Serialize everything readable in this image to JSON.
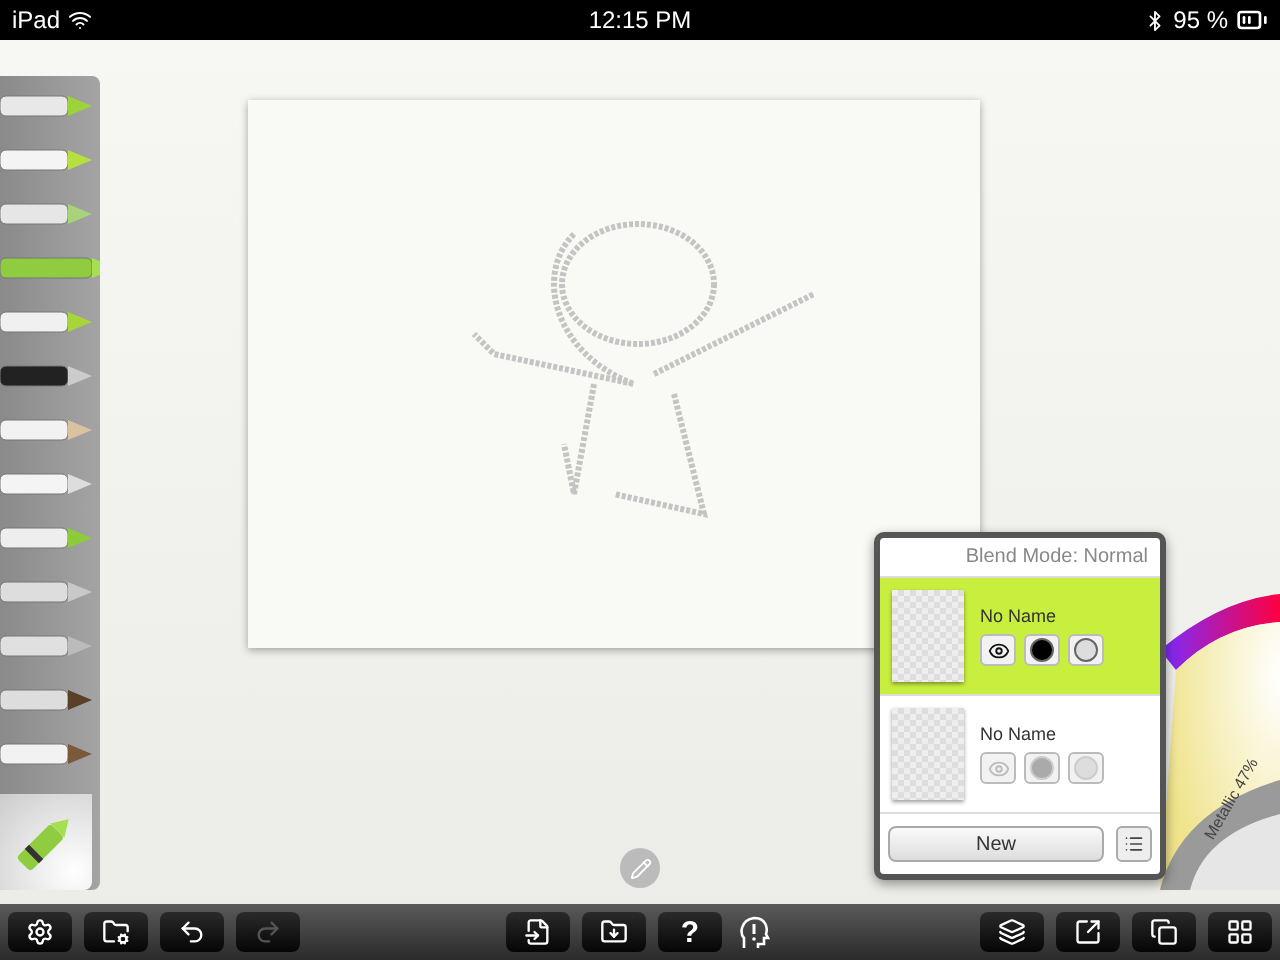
{
  "status_bar": {
    "device": "iPad",
    "time": "12:15 PM",
    "battery": "95 %"
  },
  "tools": [
    {
      "kind": "bucket",
      "selected": false
    },
    {
      "kind": "eraser",
      "selected": false
    },
    {
      "kind": "chalk",
      "selected": false
    },
    {
      "kind": "crayon",
      "selected": true
    },
    {
      "kind": "marker",
      "selected": false
    },
    {
      "kind": "pen",
      "selected": false
    },
    {
      "kind": "pencil",
      "selected": false
    },
    {
      "kind": "tube",
      "selected": false
    },
    {
      "kind": "roller",
      "selected": false
    },
    {
      "kind": "knife",
      "selected": false
    },
    {
      "kind": "airbrush",
      "selected": false
    },
    {
      "kind": "brush",
      "selected": false
    },
    {
      "kind": "flatbrush",
      "selected": false
    }
  ],
  "layers_panel": {
    "blend_mode": "Blend Mode: Normal",
    "layers": [
      {
        "name": "No Name",
        "selected": true
      },
      {
        "name": "No Name",
        "selected": false
      }
    ],
    "new_button": "New"
  },
  "color_picker": {
    "metallic": "Metallic 47%"
  },
  "toolbar": {
    "left": [
      {
        "kind": "settings",
        "disabled": false
      },
      {
        "kind": "folder-settings",
        "disabled": false
      },
      {
        "kind": "undo",
        "disabled": false
      },
      {
        "kind": "redo",
        "disabled": true
      }
    ],
    "center": [
      {
        "kind": "import",
        "disabled": false
      },
      {
        "kind": "folder-down",
        "disabled": false
      },
      {
        "kind": "help",
        "label": "?",
        "disabled": false
      },
      {
        "kind": "tips",
        "disabled": false
      }
    ],
    "right": [
      {
        "kind": "layers",
        "disabled": false
      },
      {
        "kind": "share",
        "disabled": false
      },
      {
        "kind": "copy",
        "disabled": false
      },
      {
        "kind": "gallery",
        "disabled": false
      }
    ]
  }
}
